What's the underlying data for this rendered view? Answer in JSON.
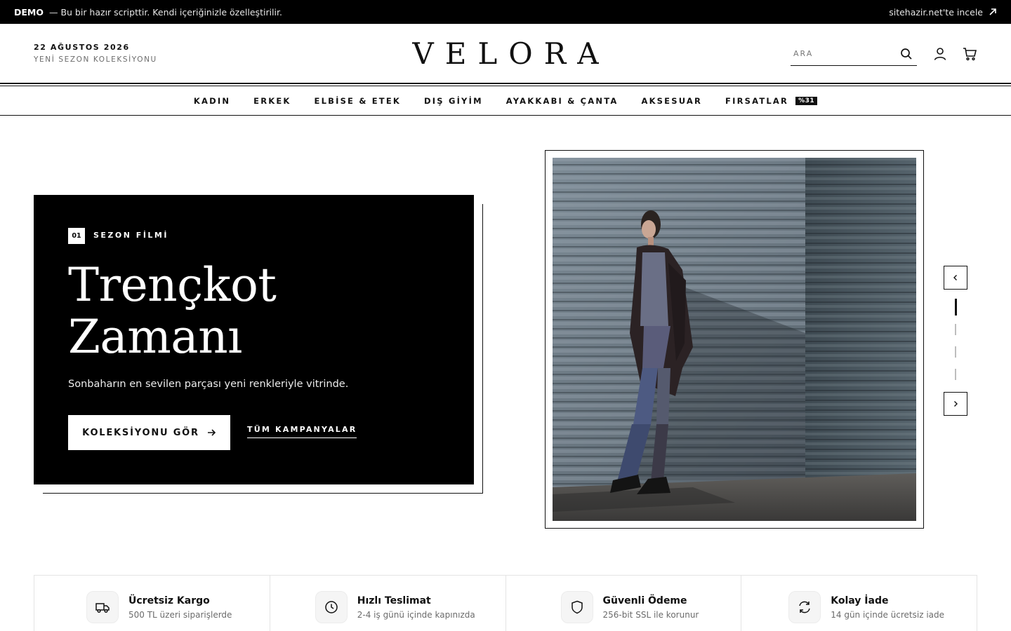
{
  "demo_bar": {
    "label": "DEMO",
    "message": "— Bu bir hazır scripttir. Kendi içeriğinizle özelleştirilir.",
    "link": "sitehazir.net'te incele"
  },
  "header": {
    "date": "22 AĞUSTOS 2026",
    "season": "YENİ SEZON KOLEKSİYONU",
    "logo": "VELORA",
    "search_placeholder": "ARA"
  },
  "nav": {
    "items": [
      "KADIN",
      "ERKEK",
      "ELBİSE & ETEK",
      "DIŞ GİYİM",
      "AYAKKABI & ÇANTA",
      "AKSESUAR",
      "FIRSATLAR"
    ],
    "badge": "%31"
  },
  "hero": {
    "number": "01",
    "kicker": "SEZON FİLMİ",
    "title_line1": "Trençkot",
    "title_line2": "Zamanı",
    "subtitle": "Sonbaharın en sevilen parçası yeni renkleriyle vitrinde.",
    "cta": "KOLEKSİYONU GÖR",
    "link": "TÜM KAMPANYALAR"
  },
  "slider": {
    "active_index": 0,
    "slide_count": 4
  },
  "features": [
    {
      "icon": "truck-icon",
      "title": "Ücretsiz Kargo",
      "subtitle": "500 TL üzeri siparişlerde"
    },
    {
      "icon": "clock-icon",
      "title": "Hızlı Teslimat",
      "subtitle": "2-4 iş günü içinde kapınızda"
    },
    {
      "icon": "shield-icon",
      "title": "Güvenli Ödeme",
      "subtitle": "256-bit SSL ile korunur"
    },
    {
      "icon": "refresh-icon",
      "title": "Kolay İade",
      "subtitle": "14 gün içinde ücretsiz iade"
    }
  ],
  "colors": {
    "primary": "#000000",
    "background": "#ffffff",
    "muted_text": "#6b6b6b"
  }
}
